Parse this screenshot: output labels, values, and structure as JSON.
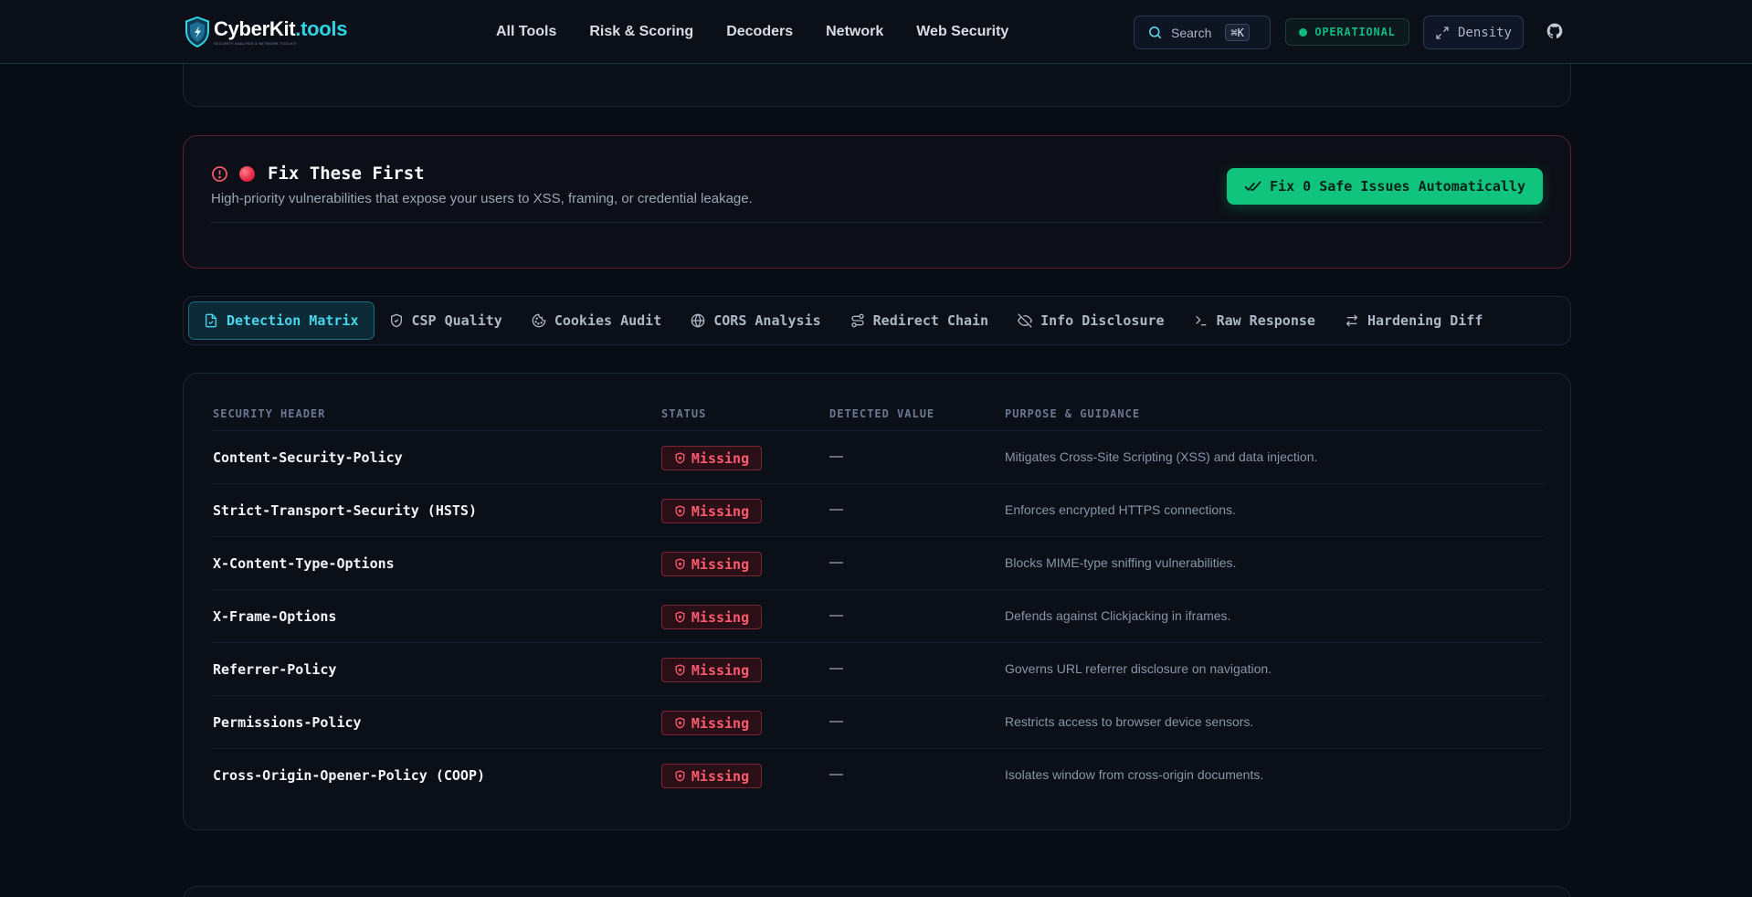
{
  "header": {
    "logo_main_a": "CyberKit",
    "logo_main_b": ".tools",
    "logo_tagline": "SECURITY ANALYSIS & NETWORK TOOLKIT",
    "nav": [
      "All Tools",
      "Risk & Scoring",
      "Decoders",
      "Network",
      "Web Security"
    ],
    "search_label": "Search",
    "search_kbd": "⌘K",
    "status_label": "OPERATIONAL",
    "density_label": "Density"
  },
  "fix": {
    "title": "Fix These First",
    "description": "High-priority vulnerabilities that expose your users to XSS, framing, or credential leakage.",
    "button_label": "Fix 0 Safe Issues Automatically"
  },
  "tabs": [
    {
      "label": "Detection Matrix",
      "icon": "file-check-icon",
      "active": true
    },
    {
      "label": "CSP Quality",
      "icon": "shield-check-icon",
      "active": false
    },
    {
      "label": "Cookies Audit",
      "icon": "cookie-icon",
      "active": false
    },
    {
      "label": "CORS Analysis",
      "icon": "globe-icon",
      "active": false
    },
    {
      "label": "Redirect Chain",
      "icon": "route-icon",
      "active": false
    },
    {
      "label": "Info Disclosure",
      "icon": "eye-off-icon",
      "active": false
    },
    {
      "label": "Raw Response",
      "icon": "terminal-icon",
      "active": false
    },
    {
      "label": "Hardening Diff",
      "icon": "swap-icon",
      "active": false
    }
  ],
  "matrix": {
    "columns": [
      "SECURITY HEADER",
      "STATUS",
      "DETECTED VALUE",
      "PURPOSE & GUIDANCE"
    ],
    "rows": [
      {
        "header": "Content-Security-Policy",
        "status": "Missing",
        "value": "—",
        "purpose": "Mitigates Cross-Site Scripting (XSS) and data injection."
      },
      {
        "header": "Strict-Transport-Security (HSTS)",
        "status": "Missing",
        "value": "—",
        "purpose": "Enforces encrypted HTTPS connections."
      },
      {
        "header": "X-Content-Type-Options",
        "status": "Missing",
        "value": "—",
        "purpose": "Blocks MIME-type sniffing vulnerabilities."
      },
      {
        "header": "X-Frame-Options",
        "status": "Missing",
        "value": "—",
        "purpose": "Defends against Clickjacking in iframes."
      },
      {
        "header": "Referrer-Policy",
        "status": "Missing",
        "value": "—",
        "purpose": "Governs URL referrer disclosure on navigation."
      },
      {
        "header": "Permissions-Policy",
        "status": "Missing",
        "value": "—",
        "purpose": "Restricts access to browser device sensors."
      },
      {
        "header": "Cross-Origin-Opener-Policy (COOP)",
        "status": "Missing",
        "value": "—",
        "purpose": "Isolates window from cross-origin documents."
      }
    ]
  },
  "colors": {
    "accent": "#2dd4e6",
    "success": "#10c47e",
    "danger": "#ff5a6e",
    "background": "#080c14"
  }
}
